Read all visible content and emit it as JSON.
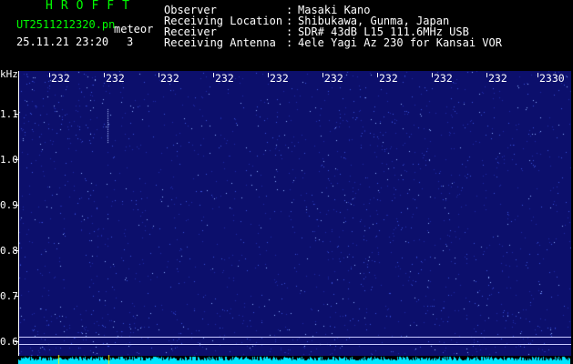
{
  "header": {
    "brand": "HROFFT",
    "filename": "UT2511212320.pn",
    "mode": "meteor",
    "datetime": "25.11.21 23:20",
    "count": "3"
  },
  "info": {
    "rows": [
      {
        "label": "Observer",
        "sep": ":",
        "value": "Masaki Kano"
      },
      {
        "label": "Receiving Location",
        "sep": ":",
        "value": "Shibukawa, Gunma, Japan"
      },
      {
        "label": "Receiver",
        "sep": ":",
        "value": "SDR# 43dB L15 111.6MHz USB"
      },
      {
        "label": "Receiving Antenna",
        "sep": ":",
        "value": "4ele Yagi Az 230 for Kansai VOR"
      }
    ]
  },
  "axis": {
    "unit": "kHz",
    "y_labels": [
      "1.1",
      "1.0",
      "0.9",
      "0.8",
      "0.7",
      "0.6"
    ],
    "time_labels": [
      "232",
      "232",
      "232",
      "232",
      "232",
      "232",
      "232",
      "232",
      "232",
      "2330"
    ]
  },
  "colors": {
    "brand": "#00ff00",
    "text": "#ffffff",
    "background": "#000000",
    "spectrogram": "#0c0f6c",
    "baseline": "#00e6ff",
    "marker": "#ffff00"
  }
}
